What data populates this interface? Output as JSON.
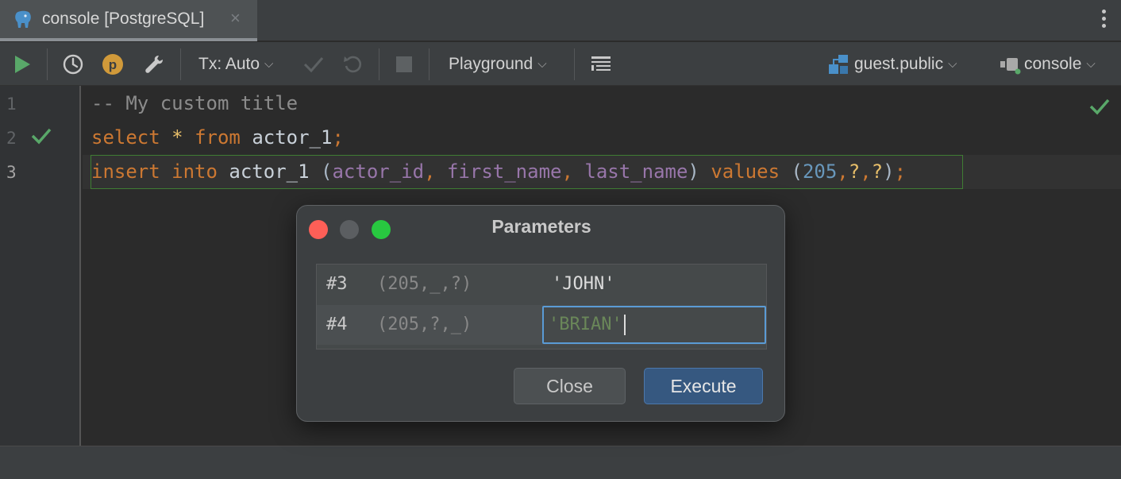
{
  "tab": {
    "title": "console [PostgreSQL]",
    "icon": "postgresql-elephant-icon",
    "close": "×"
  },
  "toolbar": {
    "tx_label": "Tx: Auto",
    "playground_label": "Playground",
    "schema_label": "guest.public",
    "session_label": "console",
    "icons": [
      "run-icon",
      "history-icon",
      "p-badge-icon",
      "wrench-icon",
      "commit-icon",
      "rollback-icon",
      "stop-icon",
      "table-view-icon",
      "schema-icon",
      "datasource-icon"
    ]
  },
  "editor": {
    "line_numbers": [
      "1",
      "2",
      "3"
    ],
    "line1": "-- My custom title",
    "line2": {
      "kw1": "select",
      "star": "*",
      "kw2": "from",
      "table": "actor_1",
      "semi": ";"
    },
    "line3": {
      "kw1": "insert",
      "kw2": "into",
      "table": "actor_1",
      "open": "(",
      "col1": "actor_id",
      "comma": ",",
      "col2": "first_name",
      "col3": "last_name",
      "close": ")",
      "kw3": "values",
      "num": "205",
      "q": "?",
      "semi": ";"
    }
  },
  "dialog": {
    "title": "Parameters",
    "rows": [
      {
        "num": "#3",
        "context": "(205,_,?)",
        "value": "'JOHN'"
      },
      {
        "num": "#4",
        "context": "(205,?,_)",
        "value": "'BRIAN'"
      }
    ],
    "close_label": "Close",
    "execute_label": "Execute",
    "colors": {
      "close_light": "#fe5f57",
      "min_light": "#5b5e61",
      "max_light": "#28c840",
      "accent": "#365880"
    }
  }
}
